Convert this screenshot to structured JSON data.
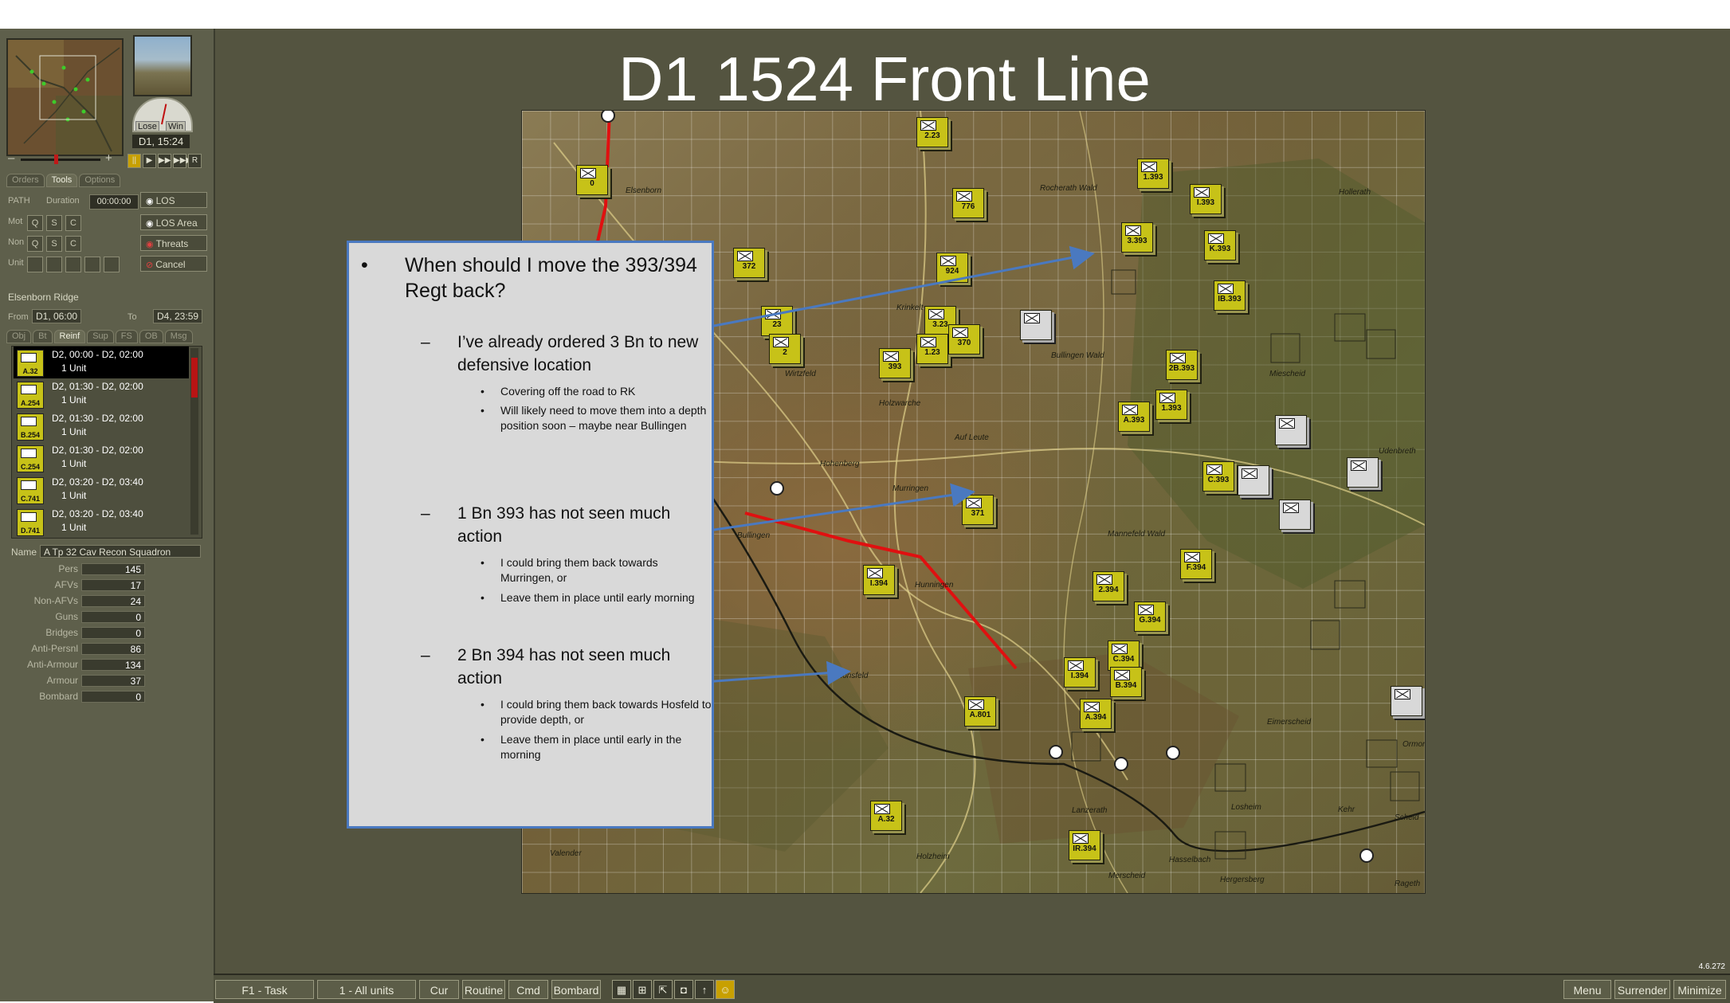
{
  "slide_title": "D1 1524 Front Line",
  "left_panel": {
    "gauge_lose": "Lose",
    "gauge_win": "Win",
    "current_time": "D1, 15:24",
    "play_controls": [
      "||",
      "▶",
      "▶▶",
      "▶▶▶",
      "R"
    ],
    "tabs": [
      "Orders",
      "Tools",
      "Options"
    ],
    "active_tab": "Tools",
    "tools": {
      "path_label": "PATH",
      "duration_label": "Duration",
      "duration_value": "00:00:00",
      "rows": [
        {
          "label": "Mot",
          "buttons": [
            "Q",
            "S",
            "C"
          ]
        },
        {
          "label": "Non",
          "buttons": [
            "Q",
            "S",
            "C"
          ]
        },
        {
          "label": "Unit",
          "buttons": [
            "",
            "",
            "",
            "",
            ""
          ]
        }
      ],
      "los": "LOS",
      "los_area": "LOS Area",
      "threats": "Threats",
      "cancel": "Cancel"
    },
    "sector_name": "Elsenborn Ridge",
    "from_label": "From",
    "from_value": "D1, 06:00",
    "to_label": "To",
    "to_value": "D4, 23:59",
    "subtabs": [
      "Obj",
      "Bt",
      "Reinf",
      "Sup",
      "FS",
      "OB",
      "Msg"
    ],
    "active_subtab": "Reinf",
    "reinforcements": [
      {
        "id": "A.32",
        "time": "D2, 00:00 - D2, 02:00",
        "units": "1 Unit"
      },
      {
        "id": "A.254",
        "time": "D2, 01:30 - D2, 02:00",
        "units": "1 Unit"
      },
      {
        "id": "B.254",
        "time": "D2, 01:30 - D2, 02:00",
        "units": "1 Unit"
      },
      {
        "id": "C.254",
        "time": "D2, 01:30 - D2, 02:00",
        "units": "1 Unit"
      },
      {
        "id": "C.741",
        "time": "D2, 03:20 - D2, 03:40",
        "units": "1 Unit"
      },
      {
        "id": "D.741",
        "time": "D2, 03:20 - D2, 03:40",
        "units": "1 Unit"
      }
    ],
    "name_label": "Name",
    "name_value": "A Tp 32 Cav Recon Squadron",
    "stats": [
      {
        "label": "Pers",
        "value": "145"
      },
      {
        "label": "AFVs",
        "value": "17"
      },
      {
        "label": "Non-AFVs",
        "value": "24"
      },
      {
        "label": "Guns",
        "value": "0"
      },
      {
        "label": "Bridges",
        "value": "0"
      },
      {
        "label": "Anti-Persnl",
        "value": "86"
      },
      {
        "label": "Anti-Armour",
        "value": "134"
      },
      {
        "label": "Armour",
        "value": "37"
      },
      {
        "label": "Bombard",
        "value": "0"
      }
    ]
  },
  "notes": {
    "question": "When should I move the 393/394 Regt back?",
    "points": [
      {
        "text": "I’ve already ordered 3 Bn to new defensive location",
        "subs": [
          "Covering off the road to RK",
          "Will likely need to move them into a depth position soon – maybe near Bullingen"
        ]
      },
      {
        "text": "1 Bn 393 has not seen much action",
        "subs": [
          "I could bring them back towards Murringen, or",
          "Leave them in place until early morning"
        ]
      },
      {
        "text": "2 Bn 394 has not seen much action",
        "subs": [
          "I could bring them back towards Hosfeld to provide depth, or",
          "Leave them in place until early in the morning"
        ]
      }
    ]
  },
  "map": {
    "place_names": [
      "Elsenborn",
      "Rocherath Wald",
      "Hollerath",
      "Krinkelt",
      "Wirtzfeld",
      "Bullingen Wald",
      "Holzwarche",
      "Hohenberg",
      "Auf Leute",
      "Murringen",
      "Bullingen",
      "Hunningen",
      "Mannefeld Wald",
      "Honsfeld",
      "Lanzerath",
      "Losheim",
      "Merscheid",
      "Hergersberg",
      "Valender",
      "Holzheim",
      "Ormont",
      "Udenbreth",
      "Miescheid",
      "Hasselbach",
      "Eimerscheid",
      "Kehr",
      "Scheid",
      "Rageth"
    ],
    "counters": [
      {
        "label": "2.23",
        "kind": "unit"
      },
      {
        "label": "1.393",
        "kind": "unit"
      },
      {
        "label": "I.393",
        "kind": "unit"
      },
      {
        "label": "776",
        "kind": "unit"
      },
      {
        "label": "3.393",
        "kind": "unit"
      },
      {
        "label": "K.393",
        "kind": "unit"
      },
      {
        "label": "0",
        "kind": "unit"
      },
      {
        "label": "372",
        "kind": "unit"
      },
      {
        "label": "924",
        "kind": "unit"
      },
      {
        "label": "IB.393",
        "kind": "unit"
      },
      {
        "label": "2B.393",
        "kind": "unit"
      },
      {
        "label": "23",
        "kind": "unit"
      },
      {
        "label": "2",
        "kind": "unit"
      },
      {
        "label": "393",
        "kind": "unit"
      },
      {
        "label": "3.23",
        "kind": "unit"
      },
      {
        "label": "1.23",
        "kind": "unit"
      },
      {
        "label": "370",
        "kind": "unit"
      },
      {
        "label": "A.393",
        "kind": "unit"
      },
      {
        "label": "1.393",
        "kind": "unit"
      },
      {
        "label": "C.393",
        "kind": "unit"
      },
      {
        "label": "371",
        "kind": "unit"
      },
      {
        "label": "F.394",
        "kind": "unit"
      },
      {
        "label": "I.394",
        "kind": "unit"
      },
      {
        "label": "2.394",
        "kind": "unit"
      },
      {
        "label": "G.394",
        "kind": "unit"
      },
      {
        "label": "I.394",
        "kind": "unit"
      },
      {
        "label": "C.394",
        "kind": "unit"
      },
      {
        "label": "B.394",
        "kind": "unit"
      },
      {
        "label": "A.394",
        "kind": "unit"
      },
      {
        "label": "A.801",
        "kind": "unit"
      },
      {
        "label": "A.32",
        "kind": "unit"
      },
      {
        "label": "IR.394",
        "kind": "unit"
      },
      {
        "label": "",
        "kind": "enemy"
      },
      {
        "label": "",
        "kind": "enemy"
      },
      {
        "label": "",
        "kind": "enemy"
      },
      {
        "label": "",
        "kind": "enemy"
      },
      {
        "label": "",
        "kind": "enemy"
      },
      {
        "label": "",
        "kind": "enemy"
      }
    ]
  },
  "bottom_bar": {
    "buttons_left": [
      "F1 - Task",
      "1 - All units",
      "Cur",
      "Routine",
      "Cmd",
      "Bombard"
    ],
    "icons": [
      "grid-icon",
      "units-icon",
      "path-icon",
      "hq-icon",
      "arrow-up-icon",
      "portrait-icon"
    ],
    "buttons_right": [
      "Menu",
      "Surrender",
      "Minimize"
    ]
  },
  "version": "4.6.272",
  "colors": {
    "accent_blue": "#4a79c0",
    "front_line_red": "#e01010",
    "unit_yellow": "#c7c218"
  }
}
